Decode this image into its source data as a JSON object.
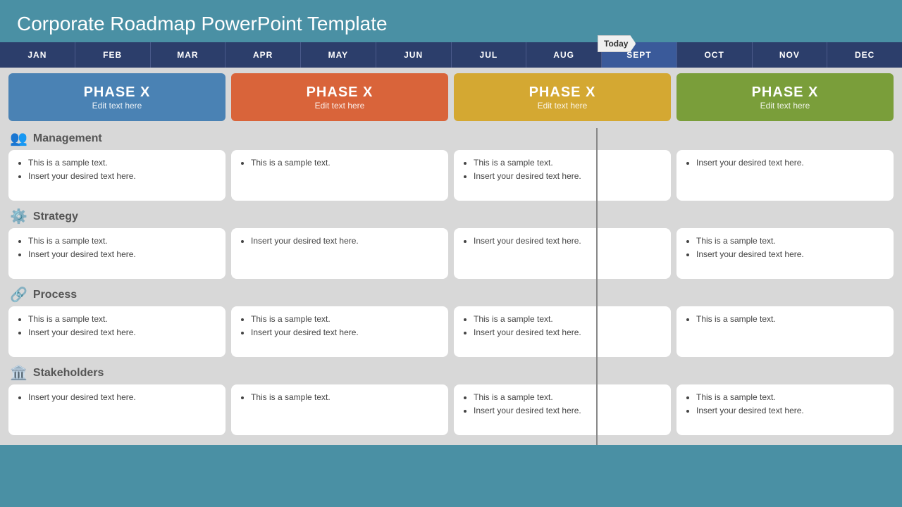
{
  "title": "Corporate Roadmap PowerPoint Template",
  "today_label": "Today",
  "months": [
    {
      "label": "JAN",
      "highlight": false
    },
    {
      "label": "FEB",
      "highlight": false
    },
    {
      "label": "MAR",
      "highlight": false
    },
    {
      "label": "APR",
      "highlight": false
    },
    {
      "label": "MAY",
      "highlight": false
    },
    {
      "label": "JUN",
      "highlight": false
    },
    {
      "label": "JUL",
      "highlight": false
    },
    {
      "label": "AUG",
      "highlight": false
    },
    {
      "label": "SEPT",
      "highlight": true
    },
    {
      "label": "OCT",
      "highlight": false
    },
    {
      "label": "NOV",
      "highlight": false
    },
    {
      "label": "DEC",
      "highlight": false
    }
  ],
  "phases": [
    {
      "label": "PHASE X",
      "sub": "Edit text here",
      "color": "blue"
    },
    {
      "label": "PHASE X",
      "sub": "Edit text here",
      "color": "orange"
    },
    {
      "label": "PHASE X",
      "sub": "Edit text here",
      "color": "yellow"
    },
    {
      "label": "PHASE X",
      "sub": "Edit text here",
      "color": "green"
    }
  ],
  "sections": [
    {
      "name": "Management",
      "icon": "👥",
      "cards": [
        {
          "items": [
            "This is a sample text.",
            "Insert your desired text here."
          ]
        },
        {
          "items": [
            "This is a sample text."
          ]
        },
        {
          "items": [
            "This is a sample text.",
            "Insert your desired text here."
          ]
        },
        {
          "items": [
            "Insert your desired text here."
          ]
        }
      ]
    },
    {
      "name": "Strategy",
      "icon": "⚙️",
      "cards": [
        {
          "items": [
            "This is a sample text.",
            "Insert your desired text here."
          ]
        },
        {
          "items": [
            "Insert your desired text here."
          ]
        },
        {
          "items": [
            "Insert your desired text here."
          ]
        },
        {
          "items": [
            "This is a sample text.",
            "Insert your desired text here."
          ]
        }
      ]
    },
    {
      "name": "Process",
      "icon": "🔗",
      "cards": [
        {
          "items": [
            "This is a sample text.",
            "Insert your desired text here."
          ]
        },
        {
          "items": [
            "This is a sample text.",
            "Insert your desired text here."
          ]
        },
        {
          "items": [
            "This is a sample text.",
            "Insert your desired text here."
          ]
        },
        {
          "items": [
            "This is a sample text."
          ]
        }
      ]
    },
    {
      "name": "Stakeholders",
      "icon": "🏛️",
      "cards": [
        {
          "items": [
            "Insert your desired text here."
          ]
        },
        {
          "items": [
            "This is a sample text."
          ]
        },
        {
          "items": [
            "This is a sample text.",
            "Insert your desired text here."
          ]
        },
        {
          "items": [
            "This is a sample text.",
            "Insert your desired text here."
          ]
        }
      ]
    }
  ]
}
